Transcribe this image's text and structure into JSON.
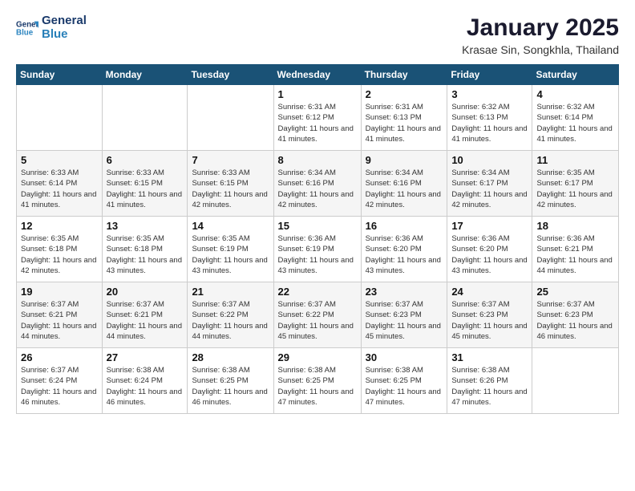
{
  "logo": {
    "line1": "General",
    "line2": "Blue"
  },
  "title": "January 2025",
  "subtitle": "Krasae Sin, Songkhla, Thailand",
  "days_of_week": [
    "Sunday",
    "Monday",
    "Tuesday",
    "Wednesday",
    "Thursday",
    "Friday",
    "Saturday"
  ],
  "weeks": [
    [
      {
        "day": "",
        "info": ""
      },
      {
        "day": "",
        "info": ""
      },
      {
        "day": "",
        "info": ""
      },
      {
        "day": "1",
        "info": "Sunrise: 6:31 AM\nSunset: 6:12 PM\nDaylight: 11 hours\nand 41 minutes."
      },
      {
        "day": "2",
        "info": "Sunrise: 6:31 AM\nSunset: 6:13 PM\nDaylight: 11 hours\nand 41 minutes."
      },
      {
        "day": "3",
        "info": "Sunrise: 6:32 AM\nSunset: 6:13 PM\nDaylight: 11 hours\nand 41 minutes."
      },
      {
        "day": "4",
        "info": "Sunrise: 6:32 AM\nSunset: 6:14 PM\nDaylight: 11 hours\nand 41 minutes."
      }
    ],
    [
      {
        "day": "5",
        "info": "Sunrise: 6:33 AM\nSunset: 6:14 PM\nDaylight: 11 hours\nand 41 minutes."
      },
      {
        "day": "6",
        "info": "Sunrise: 6:33 AM\nSunset: 6:15 PM\nDaylight: 11 hours\nand 41 minutes."
      },
      {
        "day": "7",
        "info": "Sunrise: 6:33 AM\nSunset: 6:15 PM\nDaylight: 11 hours\nand 42 minutes."
      },
      {
        "day": "8",
        "info": "Sunrise: 6:34 AM\nSunset: 6:16 PM\nDaylight: 11 hours\nand 42 minutes."
      },
      {
        "day": "9",
        "info": "Sunrise: 6:34 AM\nSunset: 6:16 PM\nDaylight: 11 hours\nand 42 minutes."
      },
      {
        "day": "10",
        "info": "Sunrise: 6:34 AM\nSunset: 6:17 PM\nDaylight: 11 hours\nand 42 minutes."
      },
      {
        "day": "11",
        "info": "Sunrise: 6:35 AM\nSunset: 6:17 PM\nDaylight: 11 hours\nand 42 minutes."
      }
    ],
    [
      {
        "day": "12",
        "info": "Sunrise: 6:35 AM\nSunset: 6:18 PM\nDaylight: 11 hours\nand 42 minutes."
      },
      {
        "day": "13",
        "info": "Sunrise: 6:35 AM\nSunset: 6:18 PM\nDaylight: 11 hours\nand 43 minutes."
      },
      {
        "day": "14",
        "info": "Sunrise: 6:35 AM\nSunset: 6:19 PM\nDaylight: 11 hours\nand 43 minutes."
      },
      {
        "day": "15",
        "info": "Sunrise: 6:36 AM\nSunset: 6:19 PM\nDaylight: 11 hours\nand 43 minutes."
      },
      {
        "day": "16",
        "info": "Sunrise: 6:36 AM\nSunset: 6:20 PM\nDaylight: 11 hours\nand 43 minutes."
      },
      {
        "day": "17",
        "info": "Sunrise: 6:36 AM\nSunset: 6:20 PM\nDaylight: 11 hours\nand 43 minutes."
      },
      {
        "day": "18",
        "info": "Sunrise: 6:36 AM\nSunset: 6:21 PM\nDaylight: 11 hours\nand 44 minutes."
      }
    ],
    [
      {
        "day": "19",
        "info": "Sunrise: 6:37 AM\nSunset: 6:21 PM\nDaylight: 11 hours\nand 44 minutes."
      },
      {
        "day": "20",
        "info": "Sunrise: 6:37 AM\nSunset: 6:21 PM\nDaylight: 11 hours\nand 44 minutes."
      },
      {
        "day": "21",
        "info": "Sunrise: 6:37 AM\nSunset: 6:22 PM\nDaylight: 11 hours\nand 44 minutes."
      },
      {
        "day": "22",
        "info": "Sunrise: 6:37 AM\nSunset: 6:22 PM\nDaylight: 11 hours\nand 45 minutes."
      },
      {
        "day": "23",
        "info": "Sunrise: 6:37 AM\nSunset: 6:23 PM\nDaylight: 11 hours\nand 45 minutes."
      },
      {
        "day": "24",
        "info": "Sunrise: 6:37 AM\nSunset: 6:23 PM\nDaylight: 11 hours\nand 45 minutes."
      },
      {
        "day": "25",
        "info": "Sunrise: 6:37 AM\nSunset: 6:23 PM\nDaylight: 11 hours\nand 46 minutes."
      }
    ],
    [
      {
        "day": "26",
        "info": "Sunrise: 6:37 AM\nSunset: 6:24 PM\nDaylight: 11 hours\nand 46 minutes."
      },
      {
        "day": "27",
        "info": "Sunrise: 6:38 AM\nSunset: 6:24 PM\nDaylight: 11 hours\nand 46 minutes."
      },
      {
        "day": "28",
        "info": "Sunrise: 6:38 AM\nSunset: 6:25 PM\nDaylight: 11 hours\nand 46 minutes."
      },
      {
        "day": "29",
        "info": "Sunrise: 6:38 AM\nSunset: 6:25 PM\nDaylight: 11 hours\nand 47 minutes."
      },
      {
        "day": "30",
        "info": "Sunrise: 6:38 AM\nSunset: 6:25 PM\nDaylight: 11 hours\nand 47 minutes."
      },
      {
        "day": "31",
        "info": "Sunrise: 6:38 AM\nSunset: 6:26 PM\nDaylight: 11 hours\nand 47 minutes."
      },
      {
        "day": "",
        "info": ""
      }
    ]
  ]
}
